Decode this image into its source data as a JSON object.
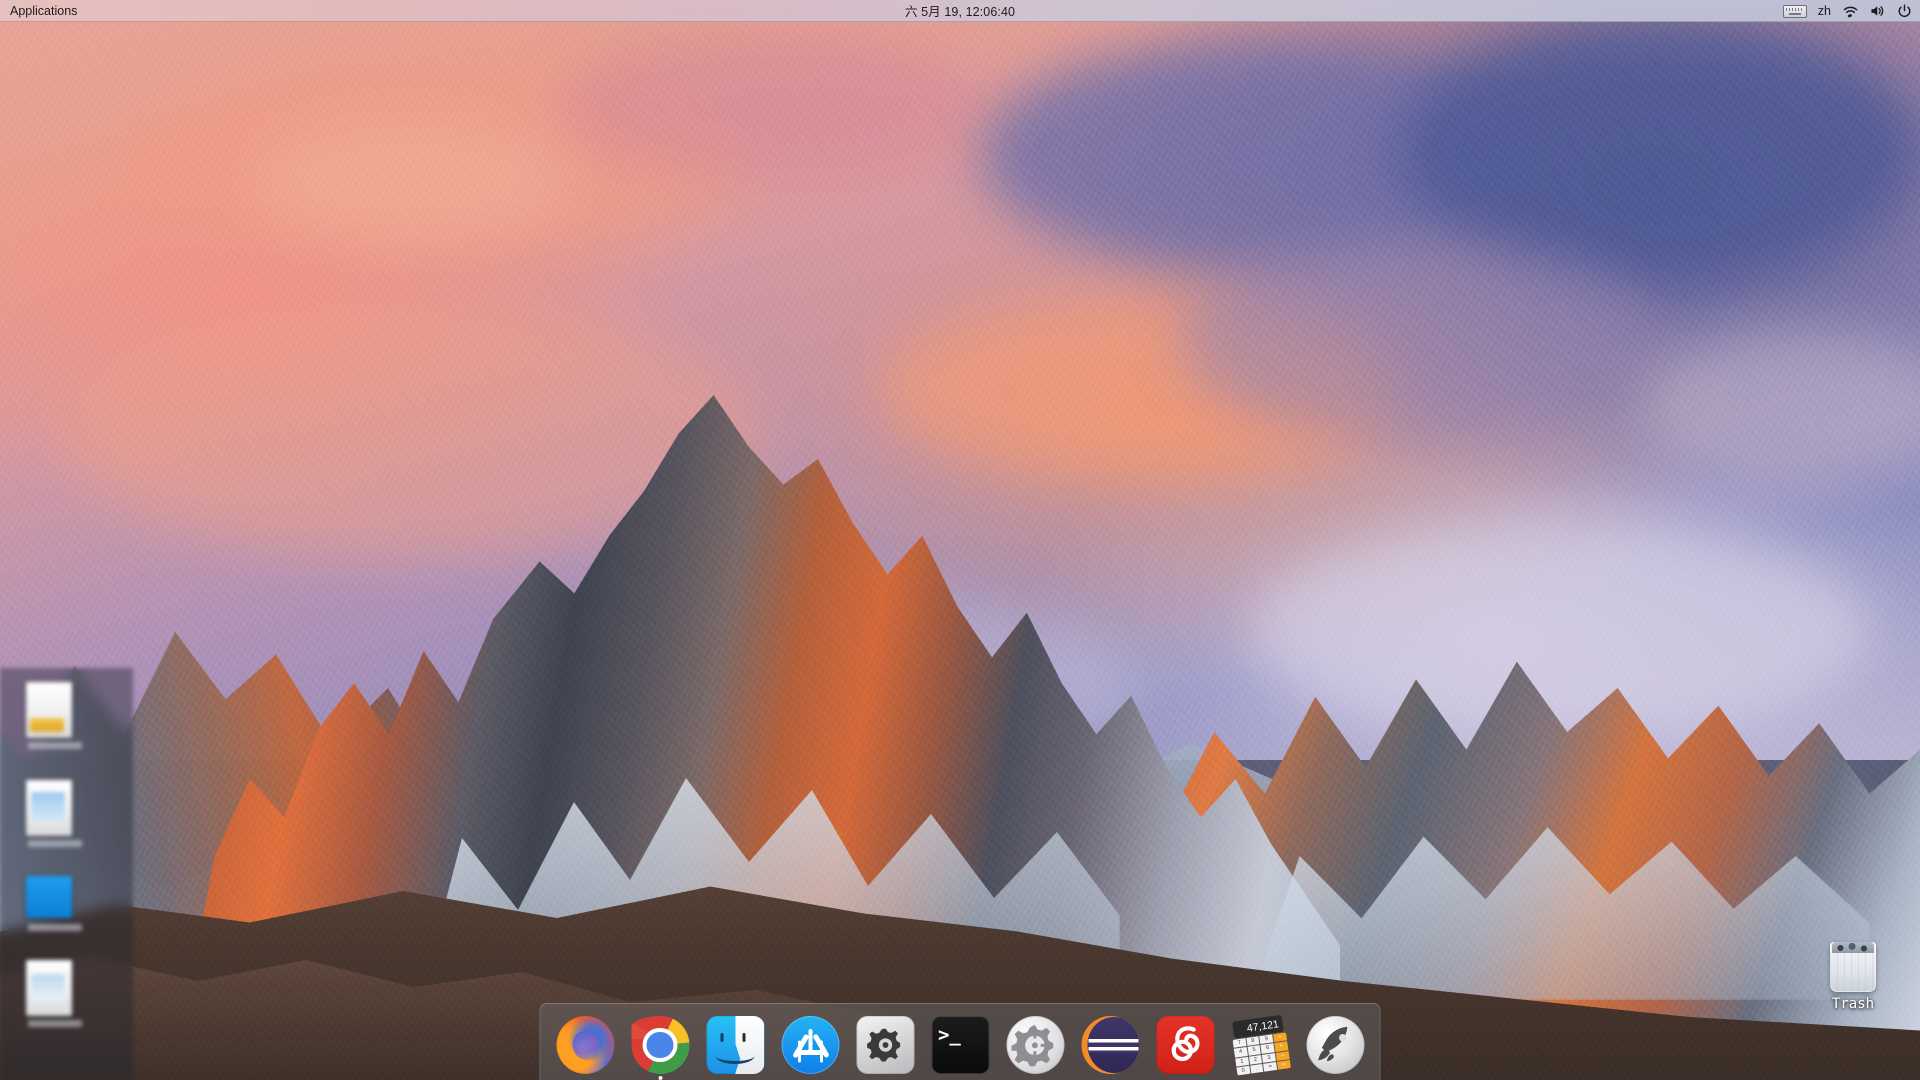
{
  "menubar": {
    "app_menu": "Applications",
    "clock": "六 5月 19, 12:06:40",
    "keyboard_icon": "keyboard-icon",
    "input_language": "zh",
    "wifi_icon": "wifi-icon",
    "volume_icon": "volume-icon",
    "power_icon": "power-icon"
  },
  "desktop": {
    "wallpaper_name": "macos-sierra-mountain-sunset",
    "trash": {
      "label": "Trash",
      "icon": "trash-icon"
    },
    "side_panel": {
      "name": "blurred-file-panel",
      "items": [
        {
          "label": ""
        },
        {
          "label": ""
        },
        {
          "label": ""
        },
        {
          "label": ""
        }
      ]
    }
  },
  "dock": {
    "items": [
      {
        "name": "firefox",
        "label": "Firefox",
        "icon": "firefox-icon",
        "running": false
      },
      {
        "name": "chrome",
        "label": "Google Chrome",
        "icon": "chrome-icon",
        "running": true
      },
      {
        "name": "finder",
        "label": "Finder",
        "icon": "finder-icon",
        "running": false
      },
      {
        "name": "app-store",
        "label": "App Store",
        "icon": "app-store-icon",
        "running": false
      },
      {
        "name": "system-preferences",
        "label": "System Preferences",
        "icon": "gear-square-icon",
        "running": false
      },
      {
        "name": "terminal",
        "label": "Terminal",
        "icon": "terminal-icon",
        "prompt": ">_",
        "running": false
      },
      {
        "name": "settings",
        "label": "Settings",
        "icon": "gear-round-icon",
        "running": false
      },
      {
        "name": "eclipse",
        "label": "Eclipse",
        "icon": "eclipse-icon",
        "running": false
      },
      {
        "name": "netease-music",
        "label": "NetEase Cloud Music",
        "icon": "netease-music-icon",
        "running": false
      },
      {
        "name": "calculator",
        "label": "Calculator",
        "icon": "calculator-icon",
        "display": "47,121",
        "running": false
      },
      {
        "name": "launchpad",
        "label": "Launchpad",
        "icon": "rocket-icon",
        "running": false
      }
    ],
    "calculator_keys": [
      "7",
      "8",
      "9",
      "÷",
      "4",
      "5",
      "6",
      "×",
      "1",
      "2",
      "3",
      "−",
      "0",
      ".",
      "=",
      "+"
    ]
  },
  "colors": {
    "menubar_text": "#1d1d1f",
    "dock_background": "rgba(122,126,134,0.33)",
    "firefox_orange": "#ff7b1c",
    "chrome_red": "#db3d35",
    "chrome_green": "#3f9c48",
    "chrome_yellow": "#f7c025",
    "chrome_blue": "#4a86e8",
    "finder_blue": "#1d90e8",
    "appstore_blue": "#0f7fe8",
    "eclipse_purple": "#3f3569",
    "eclipse_orange": "#f28c28",
    "netease_red": "#e63329",
    "calculator_orange": "#f5a623"
  }
}
